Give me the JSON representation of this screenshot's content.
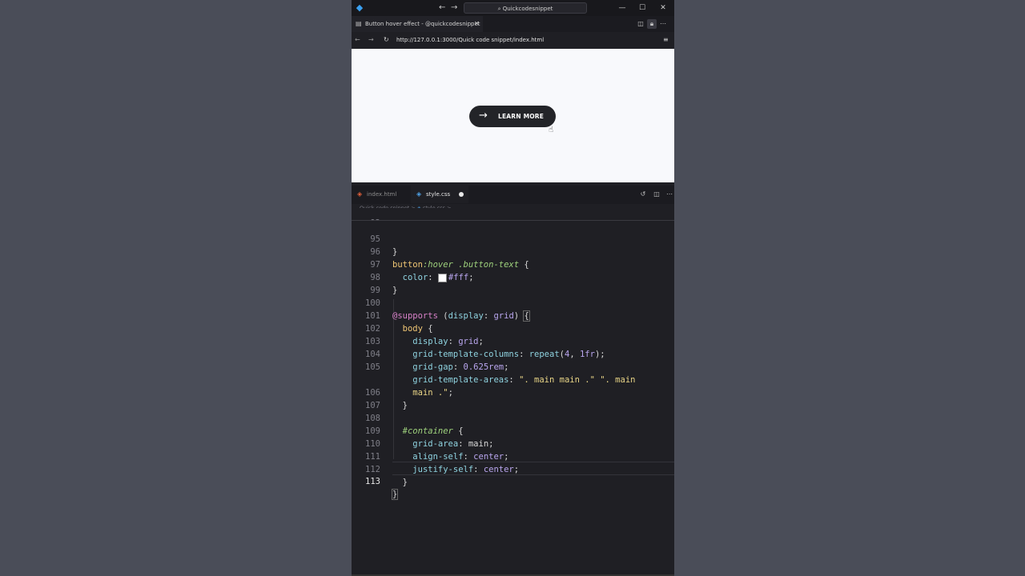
{
  "titlebar": {
    "search_text": "Quickcodesnippet",
    "back_icon": "←",
    "forward_icon": "→",
    "minimize": "—",
    "maximize": "☐",
    "close": "✕"
  },
  "browser": {
    "tab_title": "Button hover effect - @quickcodesnippet",
    "tab_close": "✕",
    "url": "http://127.0.0.1:3000/Quick code snippet/index.html"
  },
  "preview": {
    "button_arrow": "→",
    "button_label": "LEARN MORE"
  },
  "editor": {
    "tabs": [
      {
        "label": "index.html",
        "icon": "html-file-icon"
      },
      {
        "label": "style.css",
        "icon": "css-file-icon",
        "modified": true
      }
    ],
    "breadcrumb": {
      "folder": "Quick code snippet",
      "sep": ">",
      "file": "style.css",
      "tail": "> ..."
    },
    "sticky_line": {
      "number": "92",
      "text": "button:hover .circle .icon.arrow {"
    },
    "lines": [
      {
        "n": "95",
        "text": "}"
      },
      {
        "n": "96",
        "text": "button:hover .button-text {"
      },
      {
        "n": "97",
        "text": "  color: #fff;"
      },
      {
        "n": "98",
        "text": "}"
      },
      {
        "n": "99",
        "text": ""
      },
      {
        "n": "100",
        "text": "@supports (display: grid) {"
      },
      {
        "n": "101",
        "text": "  body {"
      },
      {
        "n": "102",
        "text": "    display: grid;"
      },
      {
        "n": "103",
        "text": "    grid-template-columns: repeat(4, 1fr);"
      },
      {
        "n": "104",
        "text": "    grid-gap: 0.625rem;"
      },
      {
        "n": "105",
        "text": "    grid-template-areas: \". main main .\" \". main"
      },
      {
        "n": "",
        "text": "    main .\";"
      },
      {
        "n": "106",
        "text": "  }"
      },
      {
        "n": "107",
        "text": ""
      },
      {
        "n": "108",
        "text": "  #container {"
      },
      {
        "n": "109",
        "text": "    grid-area: main;"
      },
      {
        "n": "110",
        "text": "    align-self: center;"
      },
      {
        "n": "111",
        "text": "    justify-self: center;"
      },
      {
        "n": "112",
        "text": "  }"
      },
      {
        "n": "113",
        "text": "}"
      }
    ],
    "current_line": "113",
    "color_swatch": "#ffffff"
  }
}
